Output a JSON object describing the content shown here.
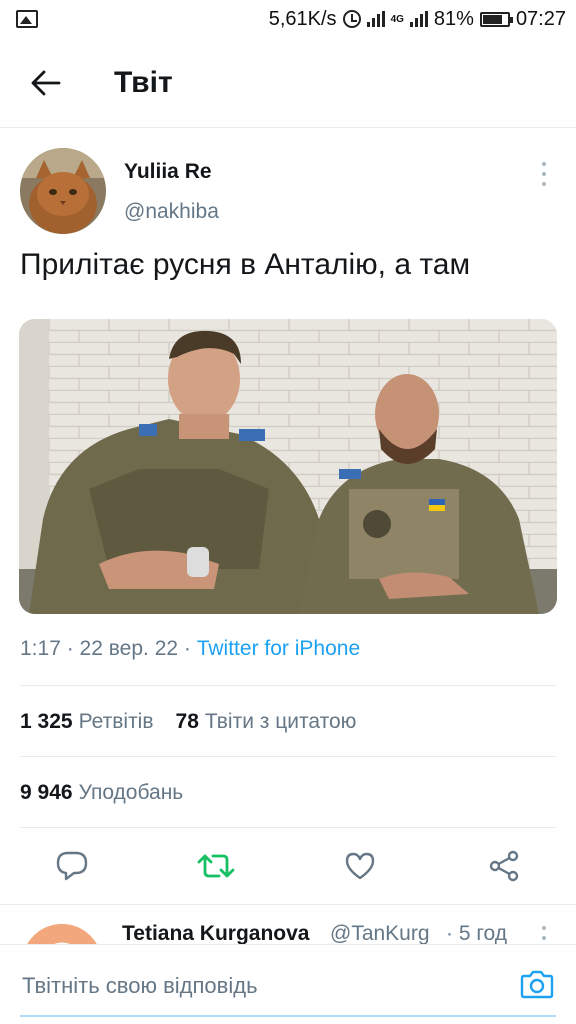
{
  "status_bar": {
    "speed": "5,61K/s",
    "net_label": "4G",
    "battery": "81%",
    "time": "07:27"
  },
  "header": {
    "title": "Твіт"
  },
  "tweet": {
    "author_name": "Yuliia Re",
    "author_handle": "@nakhiba",
    "text": "Прилітає русня в Анталію, а там",
    "time": "1:17",
    "date": "22 вер. 22",
    "source": "Twitter for iPhone",
    "separator": " · ",
    "retweets_count": "1 325",
    "retweets_label": "Ретвітів",
    "quotes_count": "78",
    "quotes_label": "Твіти з цитатою",
    "likes_count": "9 946",
    "likes_label": "Уподобань"
  },
  "reply_preview": {
    "name": "Tetiana Kurganova",
    "handle": "@TanKurg",
    "time": "· 5 год"
  },
  "compose": {
    "placeholder": "Твітніть свою відповідь"
  },
  "colors": {
    "accent": "#1da1f2",
    "retweet_green": "#17bf63",
    "secondary_text": "#657786",
    "divider": "#e6ecf0"
  }
}
